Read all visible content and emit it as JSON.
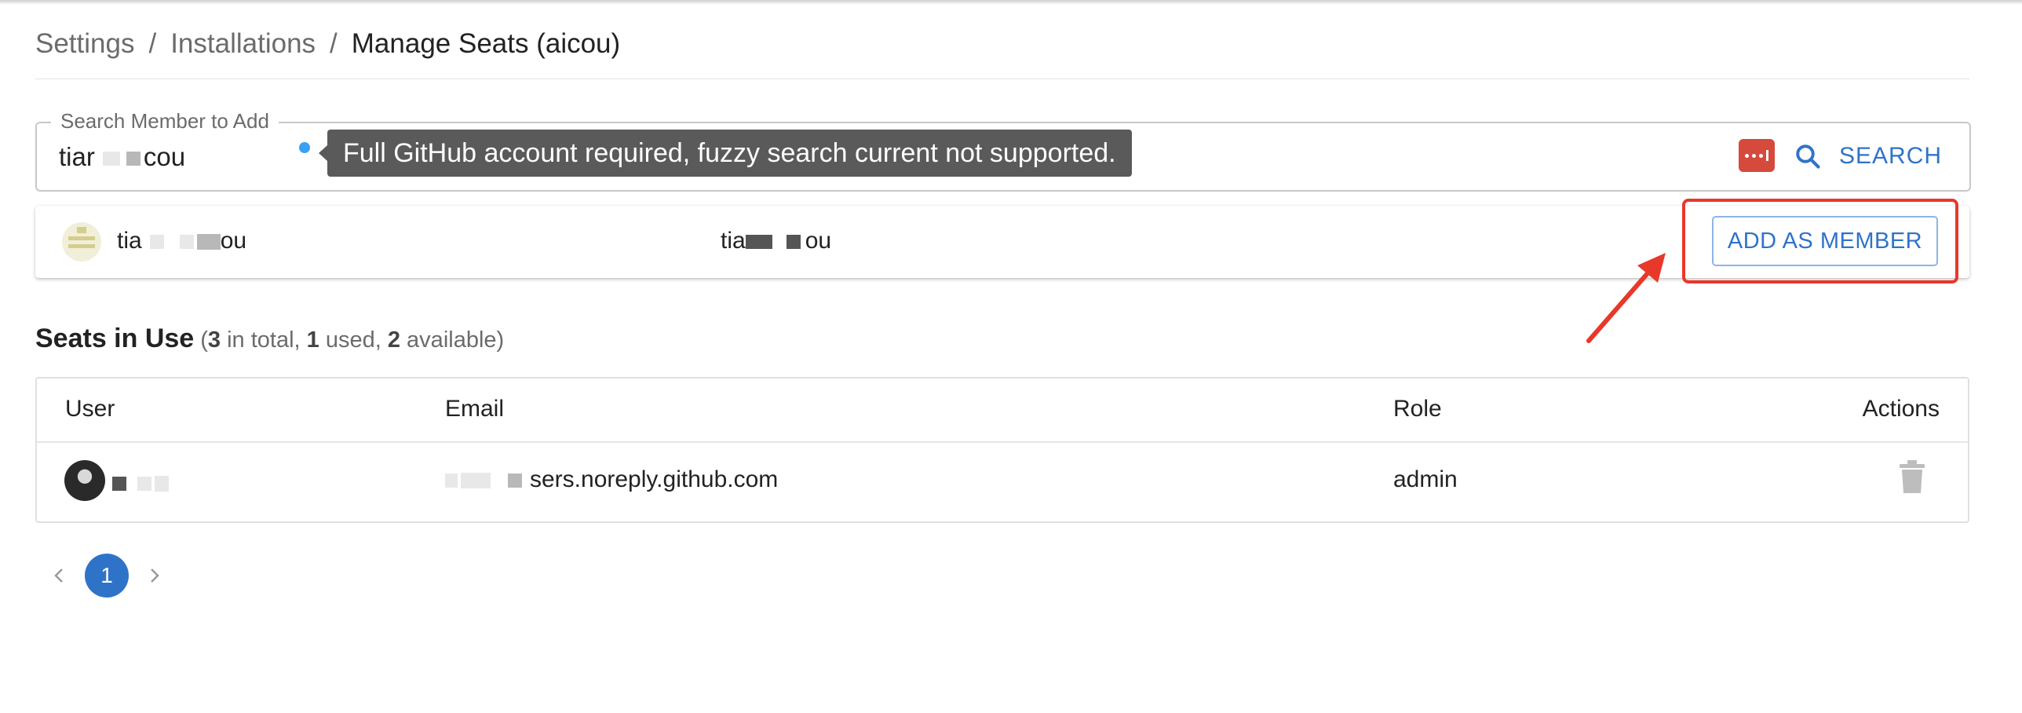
{
  "breadcrumb": {
    "items": [
      "Settings",
      "Installations"
    ],
    "separator": "/",
    "current": "Manage Seats (aicou)"
  },
  "search": {
    "legend": "Search Member to Add",
    "value_start": "tiar",
    "value_end": "cou",
    "tooltip": "Full GitHub account required, fuzzy search current not supported.",
    "button_label": "SEARCH"
  },
  "result": {
    "login_start": "tia",
    "login_end": "ou",
    "name_start": "tia",
    "name_end": "ou",
    "add_label": "ADD AS MEMBER"
  },
  "seats": {
    "title": "Seats in Use",
    "total": "3",
    "total_text": " in total, ",
    "used": "1",
    "used_text": " used, ",
    "available": "2",
    "available_text": " available)"
  },
  "table": {
    "headers": {
      "user": "User",
      "email": "Email",
      "role": "Role",
      "actions": "Actions"
    },
    "rows": [
      {
        "email_suffix": "sers.noreply.github.com",
        "role": "admin"
      }
    ]
  },
  "pagination": {
    "current_page": "1"
  },
  "colors": {
    "accent": "#2f73c9",
    "highlight": "#e8382a",
    "tooltip_bg": "#5a5a5a",
    "password_manager": "#d54a3c"
  }
}
